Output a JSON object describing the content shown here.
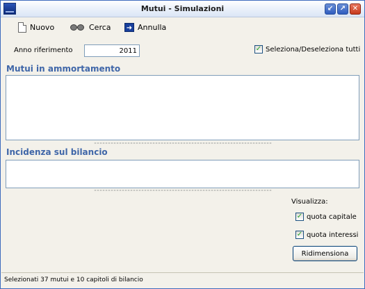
{
  "window": {
    "title": "Mutui - Simulazioni"
  },
  "toolbar": {
    "new_label": "Nuovo",
    "search_label": "Cerca",
    "cancel_label": "Annulla"
  },
  "filters": {
    "anno_label": "Anno riferimento",
    "anno_value": "2011",
    "select_all_label": "Seleziona/Deseleziona tutti",
    "select_all_checked": true
  },
  "sections": {
    "mutui_title": "Mutui in ammortamento",
    "incidenza_title": "Incidenza sul bilancio"
  },
  "visualizza": {
    "label": "Visualizza:",
    "quota_capitale_label": "quota capitale",
    "quota_capitale_checked": true,
    "quota_interessi_label": "quota interessi",
    "quota_interessi_checked": true,
    "resize_button_label": "Ridimensiona"
  },
  "status": {
    "text": "Selezionati 37 mutui e 10 capitoli di bilancio"
  },
  "colors": {
    "section_title": "#3f66a8",
    "titlebar_close": "#c63a1c",
    "window_bg": "#f3f1ea"
  }
}
